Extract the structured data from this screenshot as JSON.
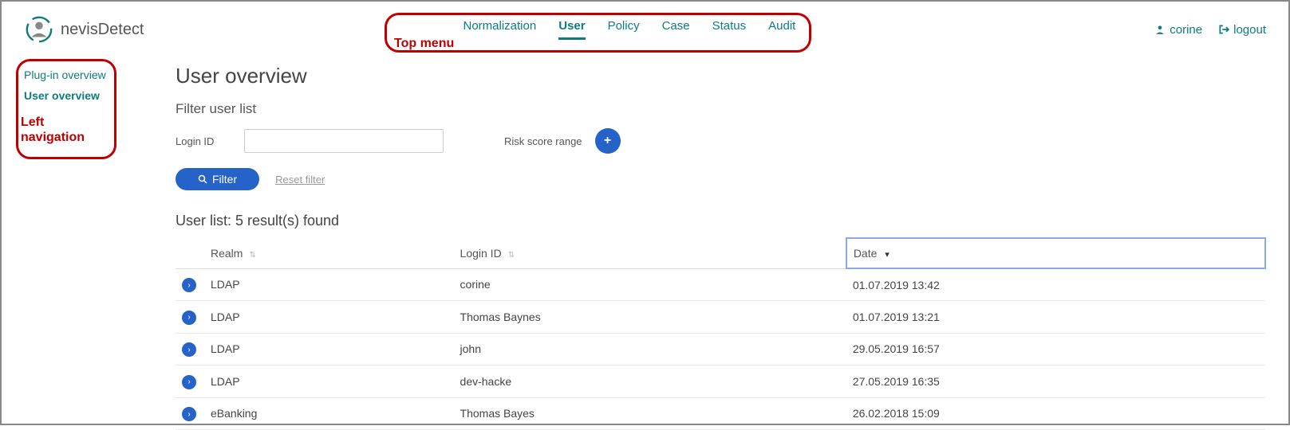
{
  "brand": {
    "name": "nevisDetect"
  },
  "top_menu": {
    "items": [
      "Normalization",
      "User",
      "Policy",
      "Case",
      "Status",
      "Audit"
    ],
    "active": "User"
  },
  "user_area": {
    "username": "corine",
    "logout": "logout"
  },
  "left_nav": {
    "items": [
      "Plug-in overview",
      "User overview"
    ],
    "active": "User overview"
  },
  "main": {
    "title": "User overview",
    "filter": {
      "title": "Filter user list",
      "login_id_label": "Login ID",
      "login_id_value": "",
      "risk_label": "Risk score range",
      "filter_btn": "Filter",
      "reset_link": "Reset filter"
    },
    "list": {
      "title": "User list: 5 result(s) found",
      "columns": {
        "realm": "Realm",
        "login_id": "Login ID",
        "date": "Date"
      },
      "sort_column": "Date",
      "rows": [
        {
          "realm": "LDAP",
          "login_id": "corine",
          "date": "01.07.2019 13:42"
        },
        {
          "realm": "LDAP",
          "login_id": "Thomas Baynes",
          "date": "01.07.2019 13:21"
        },
        {
          "realm": "LDAP",
          "login_id": "john",
          "date": "29.05.2019 16:57"
        },
        {
          "realm": "LDAP",
          "login_id": "dev-hacke",
          "date": "27.05.2019 16:35"
        },
        {
          "realm": "eBanking",
          "login_id": "Thomas Bayes",
          "date": "26.02.2018 15:09"
        }
      ]
    }
  },
  "annotations": {
    "top_menu": "Top menu",
    "left_nav": "Left navigation"
  }
}
